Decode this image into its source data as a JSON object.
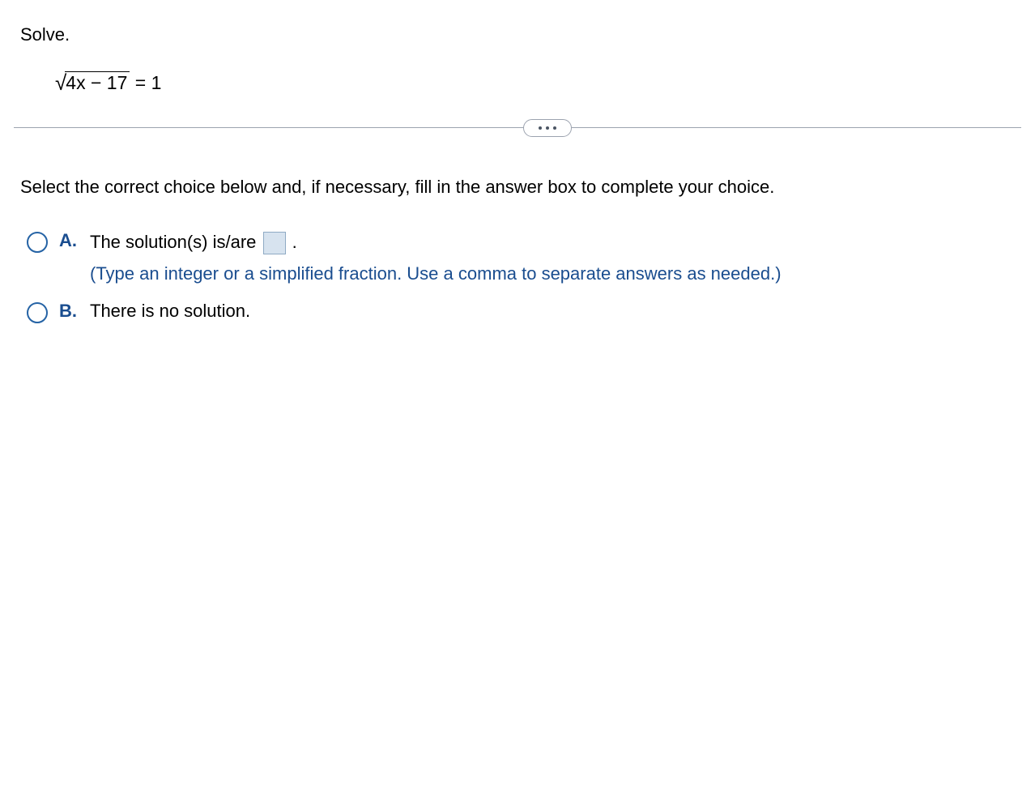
{
  "prompt": {
    "title": "Solve.",
    "radicand": "4x − 17",
    "rhs_text": " = 1"
  },
  "divider": {
    "aria": "expand"
  },
  "instruction": "Select the correct choice below and, if necessary, fill in the answer box to complete your choice.",
  "choices": {
    "A": {
      "letter": "A.",
      "text_before": "The solution(s) is/are ",
      "text_after": " .",
      "hint": "(Type an integer or a simplified fraction. Use a comma to separate answers as needed.)",
      "answer_value": ""
    },
    "B": {
      "letter": "B.",
      "text": "There is no solution."
    }
  }
}
